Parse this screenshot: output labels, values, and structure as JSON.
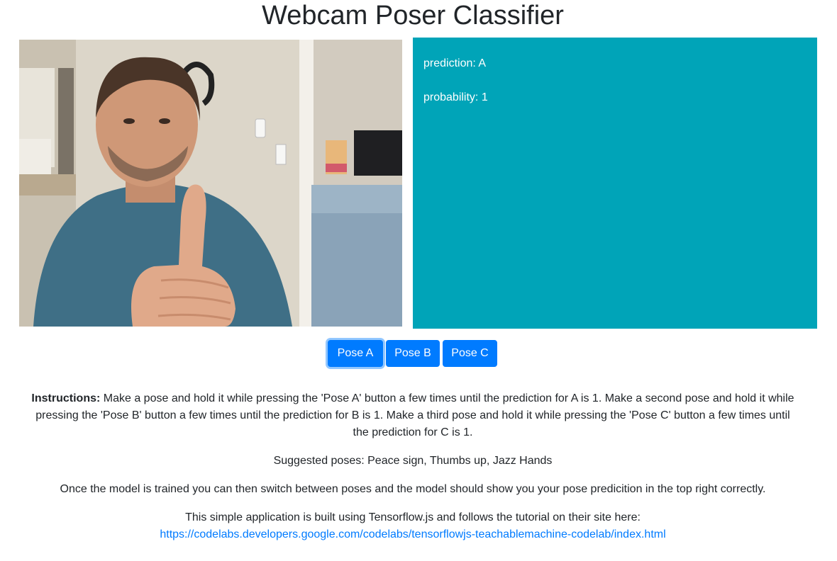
{
  "page": {
    "title": "Webcam Poser Classifier"
  },
  "prediction": {
    "prediction_text": "prediction: A",
    "probability_text": "probability: 1"
  },
  "buttons": {
    "pose_a": "Pose A",
    "pose_b": "Pose B",
    "pose_c": "Pose C"
  },
  "instructions": {
    "label": "Instructions:",
    "body": " Make a pose and hold it while pressing the 'Pose A' button a few times until the prediction for A is 1. Make a second pose and hold it while pressing the 'Pose B' button a few times until the prediction for B is 1. Make a third pose and hold it while pressing the 'Pose C' button a few times until the prediction for C is 1."
  },
  "suggested": "Suggested poses: Peace sign, Thumbs up, Jazz Hands",
  "model_note": "Once the model is trained you can then switch between poses and the model should show you your pose predicition in the top right correctly.",
  "built_with": "This simple application is built using Tensorflow.js and follows the tutorial on their site here:",
  "tutorial_link": "https://codelabs.developers.google.com/codelabs/tensorflowjs-teachablemachine-codelab/index.html",
  "colors": {
    "panel": "#00a4b8",
    "button": "#007bff",
    "link": "#007bff"
  }
}
